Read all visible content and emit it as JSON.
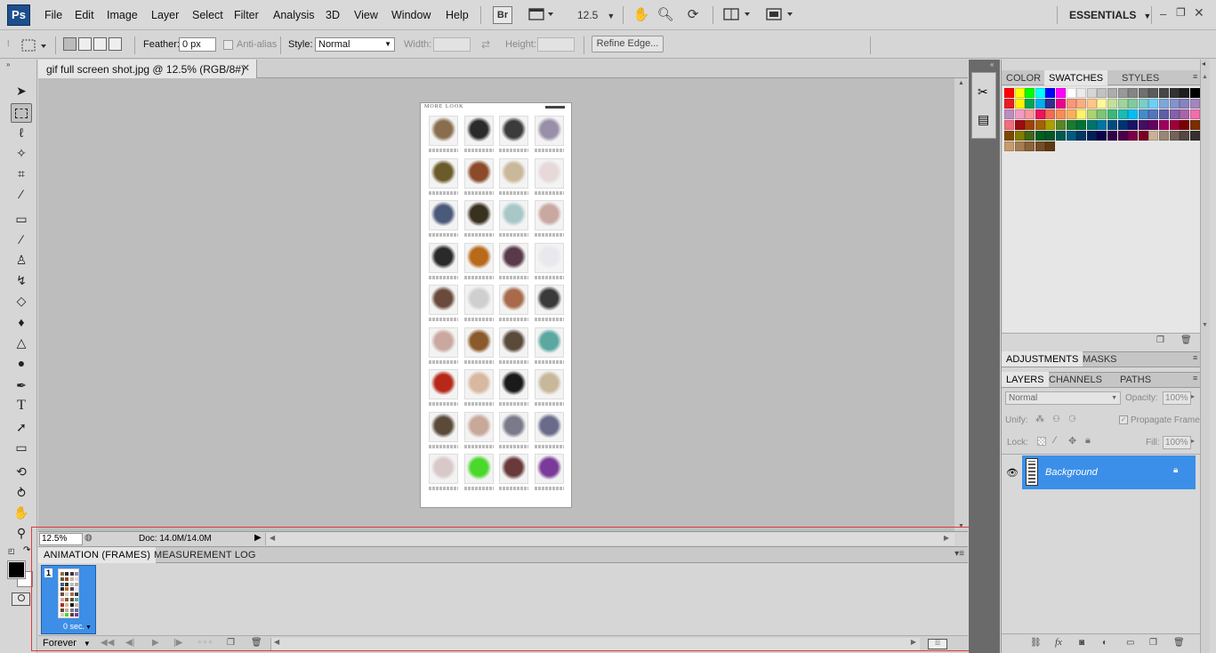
{
  "app": {
    "logo": "Ps",
    "workspace": "ESSENTIALS",
    "zoom_select": "12.5"
  },
  "menu": [
    "File",
    "Edit",
    "Image",
    "Layer",
    "Select",
    "Filter",
    "Analysis",
    "3D",
    "View",
    "Window",
    "Help"
  ],
  "toolbar": {
    "bridge": "Br"
  },
  "options": {
    "feather_label": "Feather:",
    "feather_value": "0 px",
    "antialias_label": "Anti-alias",
    "style_label": "Style:",
    "style_value": "Normal",
    "width_label": "Width:",
    "height_label": "Height:",
    "refine_edge": "Refine Edge..."
  },
  "document": {
    "tab_title": "gif full screen shot.jpg @ 12.5% (RGB/8#)",
    "image_header": "MORE LOOK",
    "zoom": "12.5%",
    "doc_info": "Doc: 14.0M/14.0M"
  },
  "animation": {
    "tabs": [
      "ANIMATION (FRAMES)",
      "MEASUREMENT LOG"
    ],
    "frame_number": "1",
    "frame_delay": "0 sec.",
    "loop": "Forever"
  },
  "right_panels": {
    "color_tabs": [
      "COLOR",
      "SWATCHES",
      "STYLES"
    ],
    "adjust_tabs": [
      "ADJUSTMENTS",
      "MASKS"
    ],
    "layer_tabs": [
      "LAYERS",
      "CHANNELS",
      "PATHS"
    ],
    "blend_mode": "Normal",
    "opacity_label": "Opacity:",
    "opacity_value": "100%",
    "unify_label": "Unify:",
    "propagate_label": "Propagate Frame 1",
    "lock_label": "Lock:",
    "fill_label": "Fill:",
    "fill_value": "100%",
    "layer_name": "Background"
  },
  "swatch_colors": [
    "#ff0000",
    "#ffff00",
    "#00ff00",
    "#00ffff",
    "#0000ff",
    "#ff00ff",
    "#ffffff",
    "#ebebeb",
    "#d6d6d6",
    "#c2c2c2",
    "#adadad",
    "#999999",
    "#858585",
    "#707070",
    "#5c5c5c",
    "#474747",
    "#333333",
    "#1f1f1f",
    "#000000",
    "#ed1c24",
    "#fff200",
    "#00a651",
    "#00aeef",
    "#2e3192",
    "#ec008c",
    "#f7977a",
    "#f9ad81",
    "#fdc68a",
    "#fff79a",
    "#c4df9b",
    "#a3d39c",
    "#82ca9d",
    "#7bcdc8",
    "#6ecff6",
    "#7ea7d8",
    "#8493ca",
    "#8882be",
    "#a187be",
    "#bc8dbf",
    "#f49ac2",
    "#f6989d",
    "#ed145b",
    "#f26c4f",
    "#f68e55",
    "#fbaf5c",
    "#fff467",
    "#acd372",
    "#7cc576",
    "#3bb878",
    "#1abbb4",
    "#00bff3",
    "#438ccb",
    "#5574b9",
    "#605ca8",
    "#8560a8",
    "#a864a8",
    "#f06eaa",
    "#f26d7d",
    "#9e0b0f",
    "#a0410d",
    "#a36209",
    "#aba000",
    "#598527",
    "#1a7b30",
    "#007236",
    "#00746b",
    "#0076a3",
    "#004b80",
    "#003471",
    "#1b1464",
    "#440e62",
    "#630460",
    "#9e005d",
    "#9e0039",
    "#790000",
    "#7b2e00",
    "#7d4900",
    "#827b00",
    "#406618",
    "#005e20",
    "#005826",
    "#005952",
    "#005b7f",
    "#003663",
    "#002157",
    "#0d004c",
    "#32004b",
    "#4b0049",
    "#7b0046",
    "#7a0026",
    "#c7b299",
    "#998675",
    "#736357",
    "#534741",
    "#37302d",
    "#c69c6d",
    "#a67c52",
    "#8c6239",
    "#754c24",
    "#603913"
  ]
}
